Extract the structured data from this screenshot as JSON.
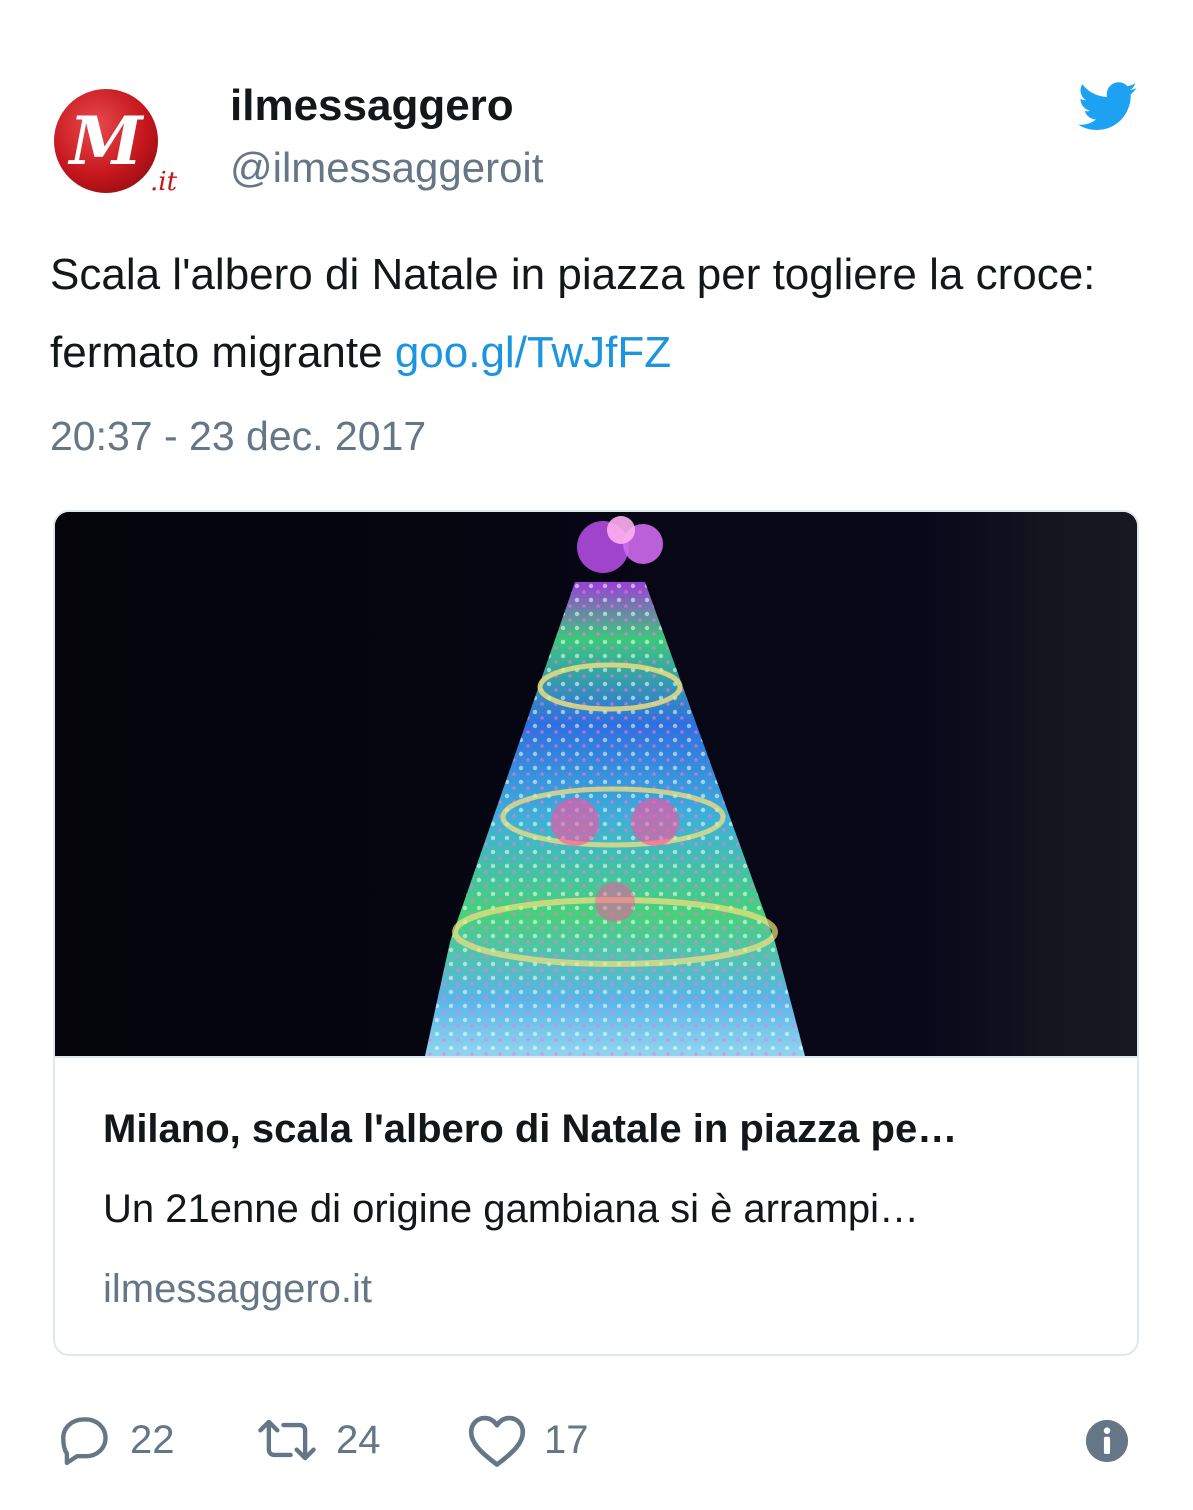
{
  "account": {
    "display_name": "ilmessaggero",
    "handle": "@ilmessaggeroit",
    "avatar_icon": "il-messaggero-logo-icon",
    "avatar_logo_suffix": ".it"
  },
  "brand": {
    "icon": "twitter-bird-icon",
    "color": "#1da1f2"
  },
  "tweet": {
    "text": "Scala l'albero di Natale in piazza per togliere la croce: fermato migrante ",
    "link": "goo.gl/TwJfFZ",
    "link_color": "#1b95e0",
    "timestamp": "20:37 - 23 dec. 2017"
  },
  "card": {
    "image_alt": "Christmas tree of lights at night",
    "title": "Milano, scala l'albero di Natale in piazza pe…",
    "description": "Un 21enne di origine gambiana si è arrampi…",
    "domain": "ilmessaggero.it"
  },
  "actions": {
    "replies": "22",
    "retweets": "24",
    "likes": "17",
    "reply_icon": "reply-bubble-icon",
    "retweet_icon": "retweet-icon",
    "like_icon": "heart-icon",
    "info_icon": "info-icon"
  },
  "colors": {
    "text_primary": "#14171a",
    "text_secondary": "#657786",
    "border": "#e1e8ed",
    "logo_red": "#c4161c"
  }
}
